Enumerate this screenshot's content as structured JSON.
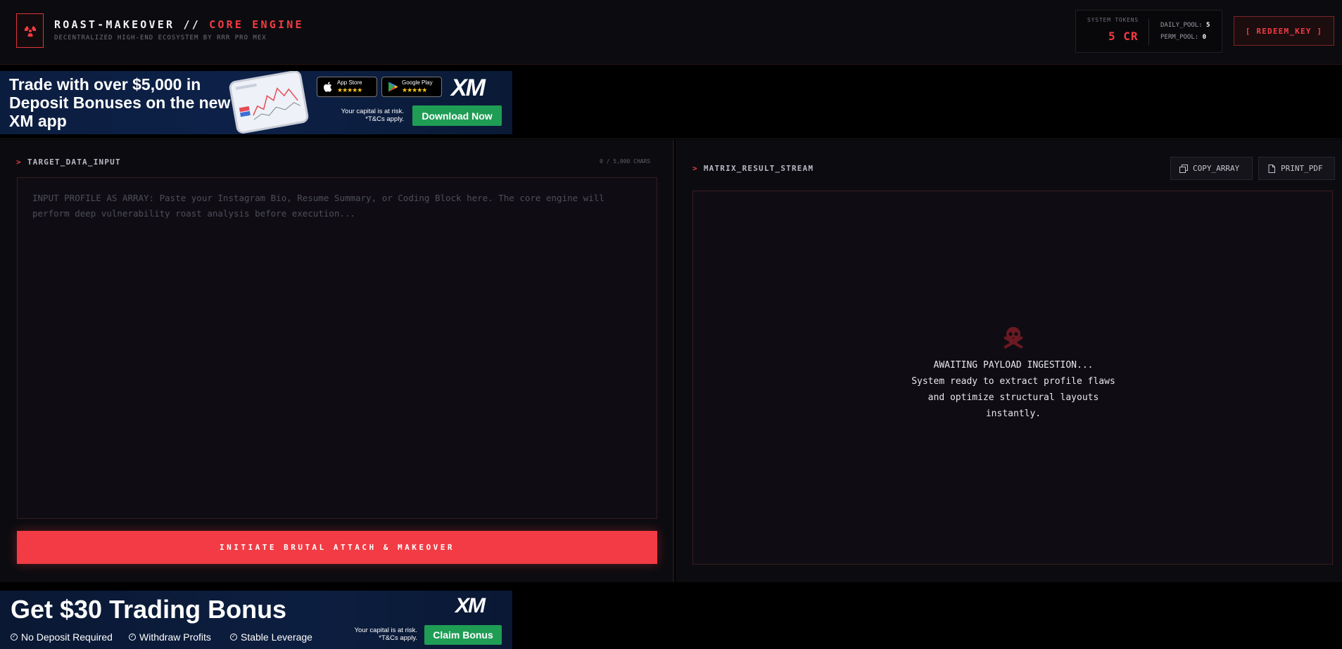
{
  "header": {
    "title_main": "ROAST-MAKEOVER // ",
    "title_accent": "CORE ENGINE",
    "subtitle": "DECENTRALIZED HIGH-END ECOSYSTEM BY RRR PRO MEX",
    "tokens": {
      "label": "SYSTEM TOKENS",
      "value": "5 CR",
      "daily_label": "DAILY_POOL:",
      "daily_value": "5",
      "perm_label": "PERM_POOL:",
      "perm_value": "0"
    },
    "redeem_label": "[ REDEEM_KEY ]",
    "accent_color": "#f23b44"
  },
  "ad_top": {
    "headline": "Trade with over $5,000 in Deposit Bonuses on the new XM app",
    "app_store_label": "App Store",
    "google_play_label": "Google Play",
    "stars": "★★★★★",
    "brand": "XM",
    "risk_line1": "Your capital is at risk.",
    "risk_line2": "*T&Cs apply.",
    "cta_label": "Download Now",
    "cta_color": "#1f9d55"
  },
  "input_panel": {
    "label": "TARGET_DATA_INPUT",
    "char_count": "0 / 5,000 CHARS",
    "placeholder": "INPUT PROFILE AS ARRAY: Paste your Instagram Bio, Resume Summary, or Coding Block here. The core engine will perform deep vulnerability roast analysis before execution...",
    "value": "",
    "submit_label": "INITIATE BRUTAL ATTACH & MAKEOVER"
  },
  "output_panel": {
    "label": "MATRIX_RESULT_STREAM",
    "copy_label": "COPY_ARRAY",
    "print_label": "PRINT_PDF",
    "status_line1": "AWAITING PAYLOAD INGESTION...",
    "status_line2": "System ready to extract profile flaws",
    "status_line3": "and optimize structural layouts",
    "status_line4": "instantly.",
    "icon": "skull-crossbones-icon"
  },
  "ad_bottom": {
    "headline": "Get $30 Trading Bonus",
    "features": [
      "No Deposit Required",
      "Withdraw Profits",
      "Stable Leverage"
    ],
    "brand": "XM",
    "risk_line1": "Your capital is at risk.",
    "risk_line2": "*T&Cs apply.",
    "cta_label": "Claim Bonus"
  }
}
